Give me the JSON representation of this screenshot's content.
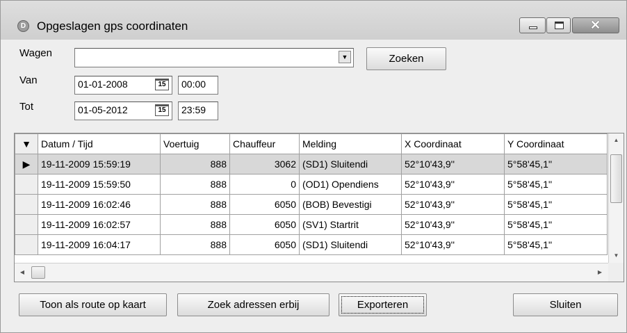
{
  "window": {
    "title": "Opgeslagen gps coordinaten",
    "icon": "app-icon",
    "controls": {
      "minimize": "minimize-icon",
      "maximize": "maximize-icon",
      "close_glyph": "✕"
    }
  },
  "filters": {
    "wagen_label": "Wagen",
    "wagen_value": "",
    "van_label": "Van",
    "van_date": "01-01-2008",
    "van_time": "00:00",
    "tot_label": "Tot",
    "tot_date": "01-05-2012",
    "tot_time": "23:59",
    "calendar_glyph": "15",
    "search_button": "Zoeken"
  },
  "table": {
    "sort_glyph": "▼",
    "columns": [
      "Datum / Tijd",
      "Voertuig",
      "Chauffeur",
      "Melding",
      "X Coordinaat",
      "Y Coordinaat"
    ],
    "rows": [
      [
        "19-11-2009 15:59:19",
        "888",
        "3062",
        "(SD1) Sluitendi",
        "52°10'43,9''",
        "5°58'45,1''"
      ],
      [
        "19-11-2009 15:59:50",
        "888",
        "0",
        "(OD1) Opendiens",
        "52°10'43,9''",
        "5°58'45,1''"
      ],
      [
        "19-11-2009 16:02:46",
        "888",
        "6050",
        "(BOB) Bevestigi",
        "52°10'43,9''",
        "5°58'45,1''"
      ],
      [
        "19-11-2009 16:02:57",
        "888",
        "6050",
        "(SV1) Startrit",
        "52°10'43,9''",
        "5°58'45,1''"
      ],
      [
        "19-11-2009 16:04:17",
        "888",
        "6050",
        "(SD1) Sluitendi",
        "52°10'43,9''",
        "5°58'45,1''"
      ]
    ],
    "current_row_glyph": "▶"
  },
  "actions": {
    "route_button": "Toon als route op kaart",
    "address_button": "Zoek adressen erbij",
    "export_button": "Exporteren",
    "close_button": "Sluiten"
  },
  "colors": {
    "selected_row": "#d8d8d8",
    "window_bg": "#eeeeee"
  }
}
